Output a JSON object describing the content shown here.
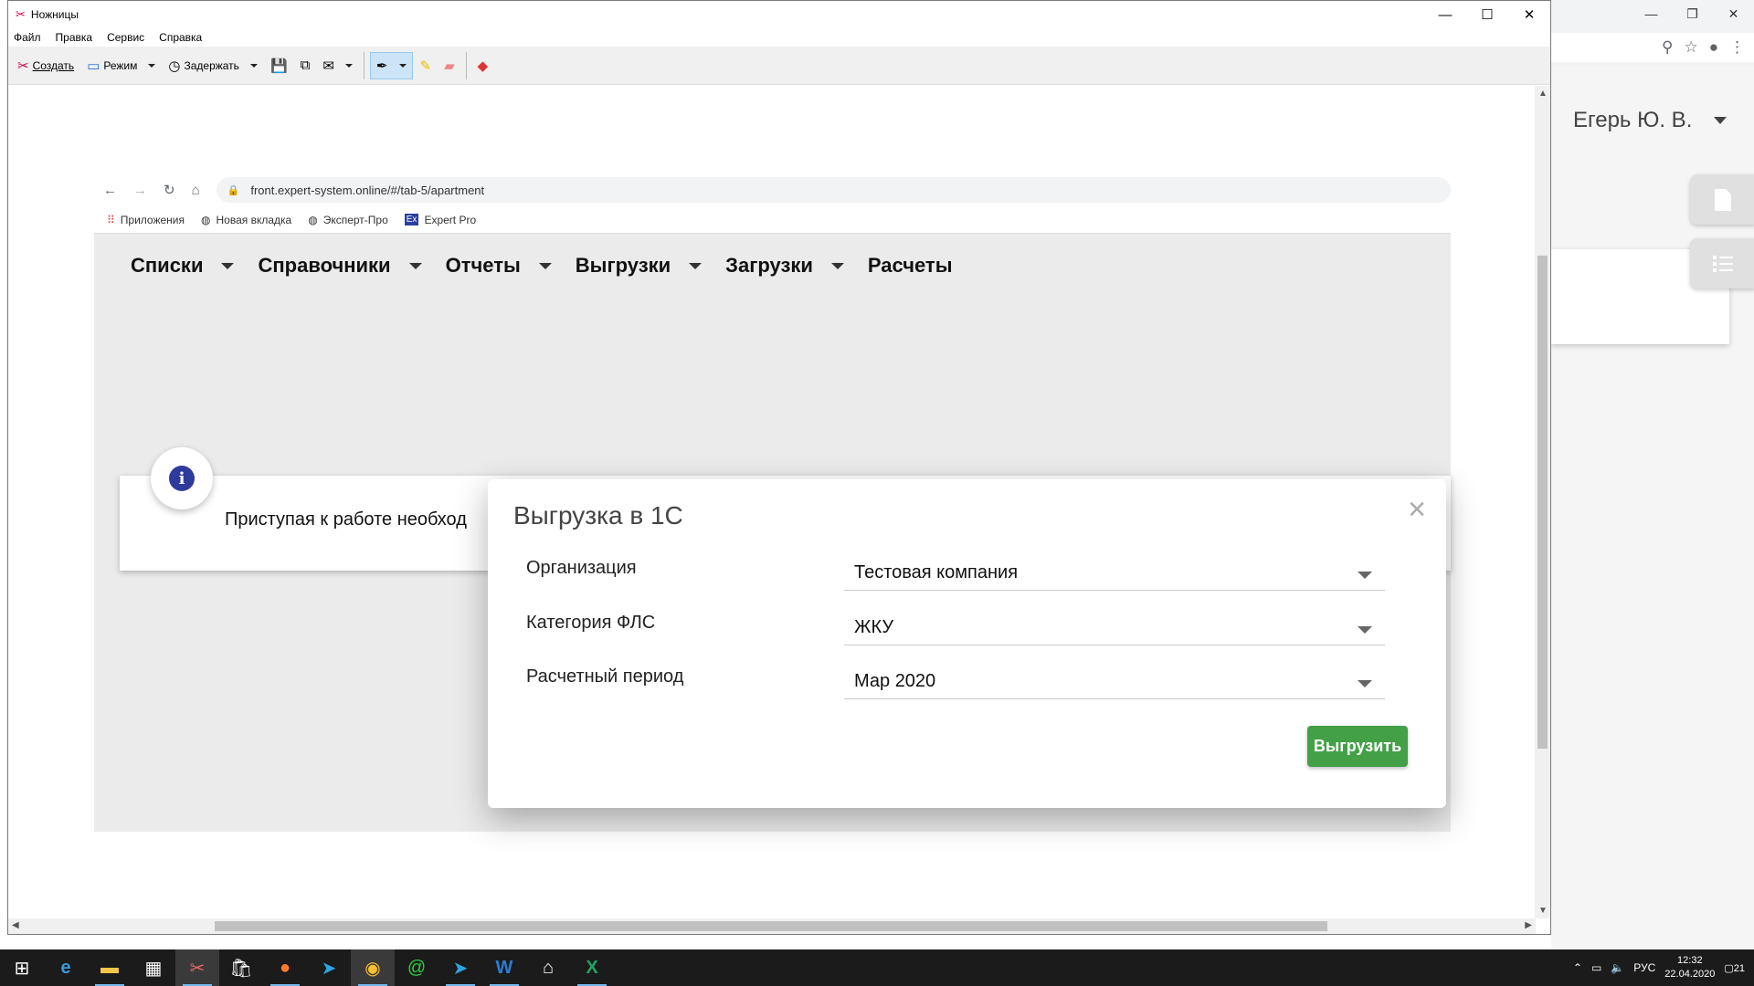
{
  "background_window": {
    "user_name": "Егерь Ю. В."
  },
  "snip": {
    "title": "Ножницы",
    "menu": [
      "Файл",
      "Правка",
      "Сервис",
      "Справка"
    ],
    "toolbar": {
      "create": "Создать",
      "mode": "Режим",
      "delay": "Задержать"
    }
  },
  "capture": {
    "url": "front.expert-system.online/#/tab-5/apartment",
    "bookmarks": [
      "Приложения",
      "Новая вкладка",
      "Эксперт-Про",
      "Expert Pro"
    ],
    "nav": [
      "Списки",
      "Справочники",
      "Отчеты",
      "Выгрузки",
      "Загрузки",
      "Расчеты"
    ],
    "info_text": "Приступая к работе необход",
    "info_icon_letter": "i",
    "modal": {
      "title": "Выгрузка в 1С",
      "close": "×",
      "rows": [
        {
          "label": "Организация",
          "value": "Тестовая компания"
        },
        {
          "label": "Категория ФЛС",
          "value": "ЖКУ"
        },
        {
          "label": "Расчетный период",
          "value": "Мар 2020"
        }
      ],
      "submit": "Выгрузить"
    }
  },
  "taskbar": {
    "language": "РУС",
    "time": "12:32",
    "date": "22.04.2020",
    "notifications": "21"
  },
  "colors": {
    "accent_green": "#43a047",
    "info_blue": "#2f3b9c",
    "taskbar_bg": "#1b1b1b"
  }
}
